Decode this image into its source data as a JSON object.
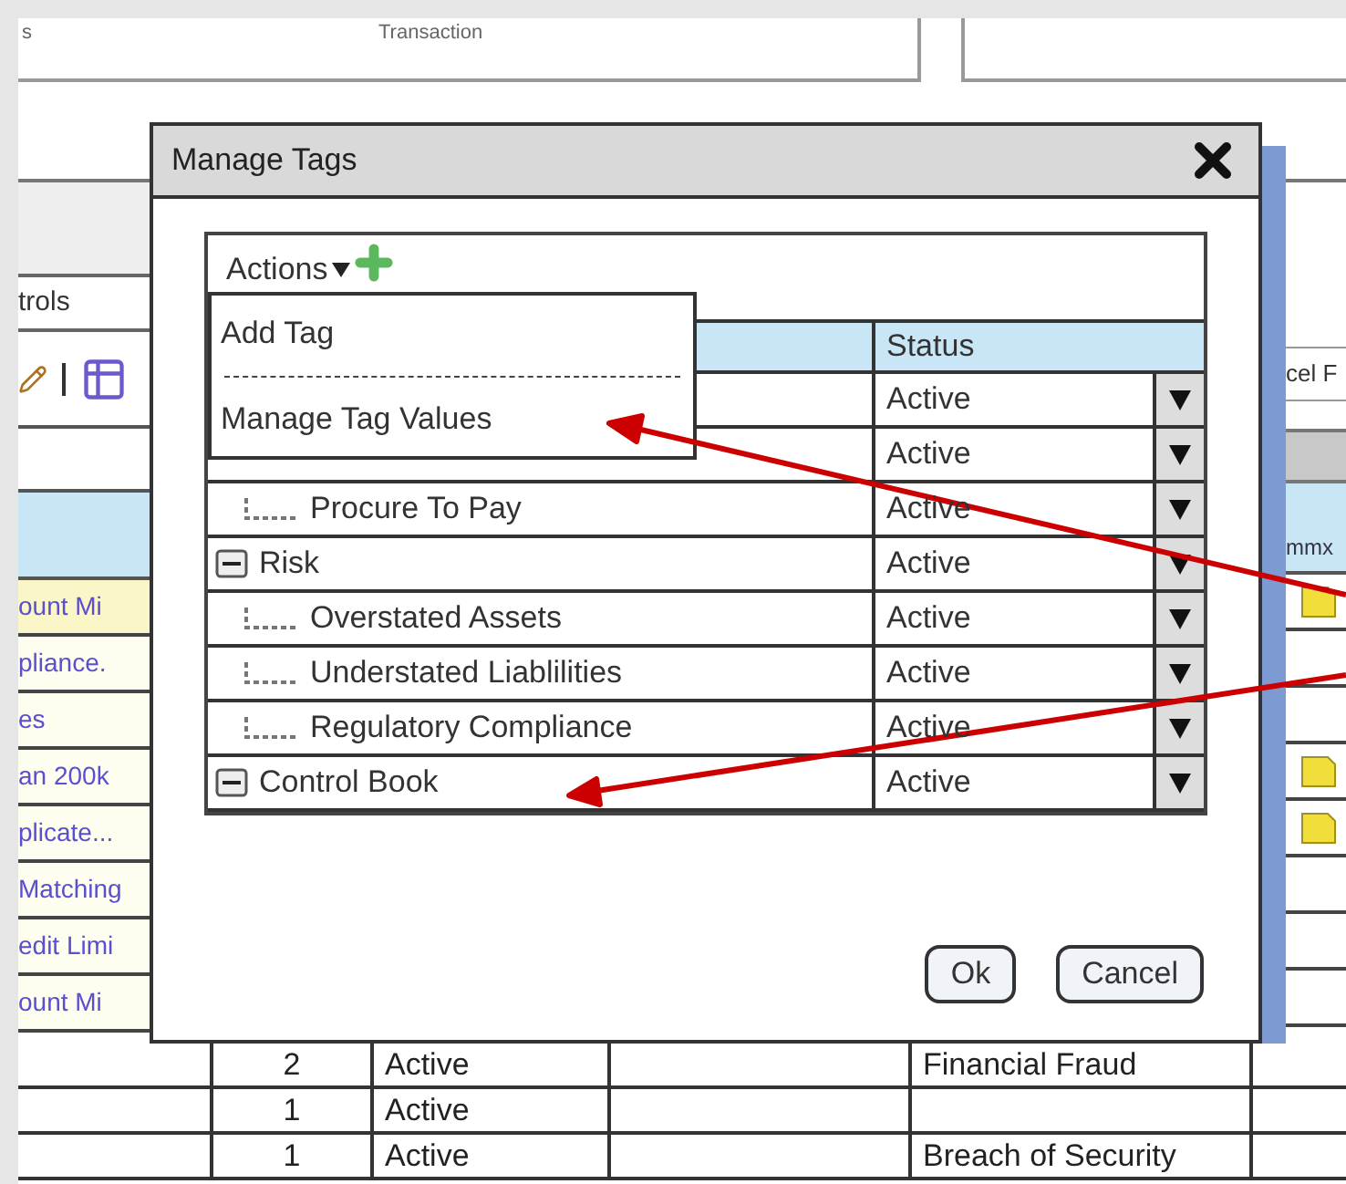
{
  "background": {
    "top_tabs": [
      {
        "label": "s"
      },
      {
        "label": "Transaction"
      }
    ],
    "left_panel": {
      "tab_label": "trols",
      "links": [
        {
          "label": "ount Mi",
          "selected": true
        },
        {
          "label": "pliance.",
          "selected": false
        },
        {
          "label": "es",
          "selected": false
        },
        {
          "label": "an 200k",
          "selected": false
        },
        {
          "label": "plicate...",
          "selected": false
        },
        {
          "label": "Matching",
          "selected": false
        },
        {
          "label": "edit Limi",
          "selected": false
        },
        {
          "label": "ount Mi",
          "selected": false
        }
      ]
    },
    "right_panel": {
      "button_label": "cel F",
      "column_header": "mmx",
      "rows": [
        {
          "has_note": true
        },
        {
          "has_note": false
        },
        {
          "has_note": false
        },
        {
          "has_note": true
        },
        {
          "has_note": true
        },
        {
          "has_note": false
        },
        {
          "has_note": false
        },
        {
          "has_note": false
        }
      ]
    },
    "table_rows": [
      {
        "count": "2",
        "status": "Active",
        "category": "Financial Fraud"
      },
      {
        "count": "1",
        "status": "Active",
        "category": ""
      },
      {
        "count": "1",
        "status": "Active",
        "category": "Breach of Security"
      }
    ]
  },
  "dialog": {
    "title": "Manage Tags",
    "actions_label": "Actions",
    "menu": [
      {
        "kind": "item",
        "label": "Add Tag"
      },
      {
        "kind": "separator"
      },
      {
        "kind": "item",
        "label": "Manage Tag Values"
      }
    ],
    "status_header": "Status",
    "tree": [
      {
        "status": "Active",
        "children": [
          {
            "status": "Active"
          },
          {
            "label": "Procure To Pay",
            "status": "Active"
          }
        ]
      },
      {
        "label": "Risk",
        "expanded": true,
        "status": "Active",
        "children": [
          {
            "label": "Overstated Assets",
            "status": "Active"
          },
          {
            "label": "Understated Liablilities",
            "status": "Active"
          },
          {
            "label": "Regulatory Compliance",
            "status": "Active"
          }
        ]
      },
      {
        "label": "Control Book",
        "expanded": true,
        "status": "Active"
      }
    ],
    "buttons": [
      "Ok",
      "Cancel"
    ]
  }
}
